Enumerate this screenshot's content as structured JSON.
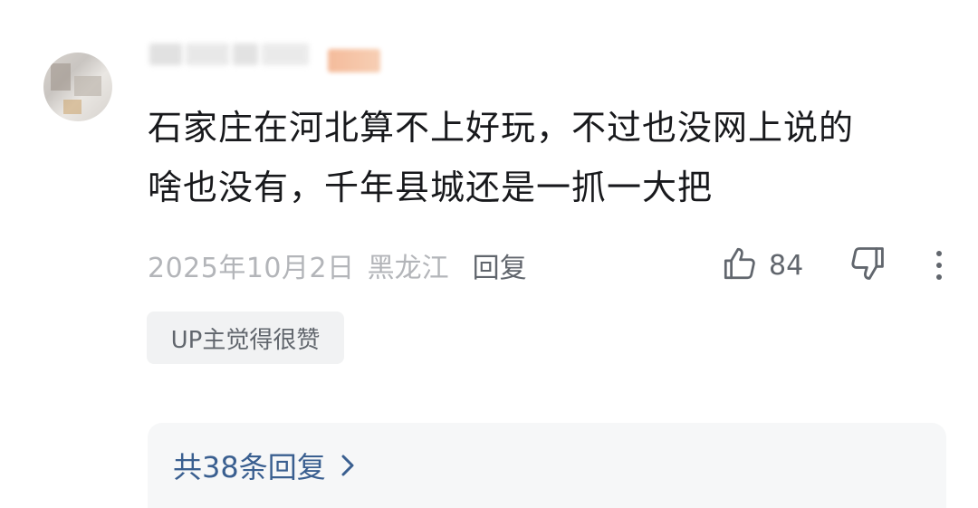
{
  "comment": {
    "username": "",
    "content_lines": [
      "石家庄在河北算不上好玩，不过也没网上说的",
      "啥也没有，千年县城还是一抓一大把"
    ],
    "date": "2025年10月2日",
    "location": "黑龙江",
    "reply_label": "回复",
    "like_count": "84",
    "up_tag": "UP主觉得很赞",
    "replies_link": "共38条回复"
  },
  "icons": {
    "like": "thumbs-up-icon",
    "dislike": "thumbs-down-icon",
    "more": "more-vertical-icon",
    "chevron": "chevron-right-icon"
  },
  "colors": {
    "text_primary": "#18191c",
    "text_meta": "#b3b5b9",
    "text_secondary": "#61666d",
    "link_blue": "#3a5f90",
    "tag_bg": "#f1f2f3",
    "reply_box_bg": "#f6f7f8"
  }
}
